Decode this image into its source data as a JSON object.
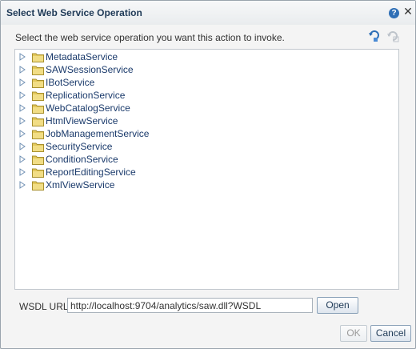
{
  "dialog": {
    "title": "Select Web Service Operation",
    "instruction": "Select the web service operation you want this action to invoke.",
    "help_icon_glyph": "?",
    "close_icon_glyph": "✕"
  },
  "toolbar": {
    "icons": [
      "refresh-icon",
      "refresh-disabled-icon"
    ]
  },
  "tree": {
    "items": [
      {
        "label": "MetadataService"
      },
      {
        "label": "SAWSessionService"
      },
      {
        "label": "IBotService"
      },
      {
        "label": "ReplicationService"
      },
      {
        "label": "WebCatalogService"
      },
      {
        "label": "HtmlViewService"
      },
      {
        "label": "JobManagementService"
      },
      {
        "label": "SecurityService"
      },
      {
        "label": "ConditionService"
      },
      {
        "label": "ReportEditingService"
      },
      {
        "label": "XmlViewService"
      }
    ]
  },
  "wsdl": {
    "label": "WSDL URL",
    "value": "http://localhost:9704/analytics/saw.dll?WSDL",
    "open_label": "Open"
  },
  "footer": {
    "ok_label": "OK",
    "cancel_label": "Cancel"
  },
  "colors": {
    "title": "#1f3a57",
    "tree_label": "#1a3a6b",
    "folder": "#e3c85a",
    "twisty": "#6f8fb3"
  }
}
